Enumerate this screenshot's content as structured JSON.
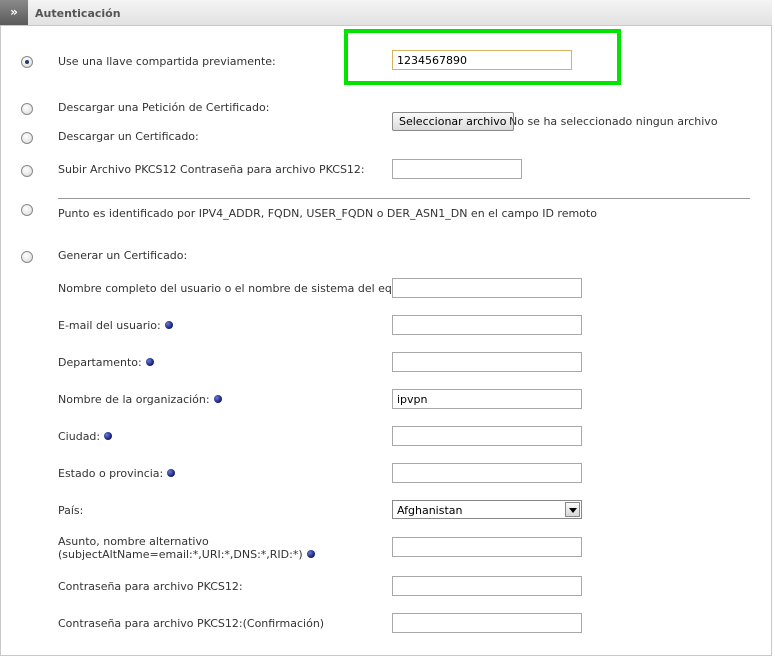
{
  "header": {
    "toggle_icon": "»",
    "title": "Autenticación"
  },
  "psk": {
    "label": "Use una llave compartida previamente:",
    "value": "1234567890",
    "selected": true
  },
  "download_request": {
    "label": "Descargar una Petición de Certificado:"
  },
  "download_cert": {
    "label": "Descargar un Certificado:"
  },
  "file_upload": {
    "button_label": "Seleccionar archivo",
    "status": "No se ha seleccionado ningun archivo"
  },
  "pkcs12_upload": {
    "label": "Subir Archivo PKCS12 Contraseña para archivo PKCS12:",
    "value": ""
  },
  "peer_id": {
    "label": "Punto es identificado por IPV4_ADDR, FQDN, USER_FQDN o DER_ASN1_DN en el campo ID remoto"
  },
  "generate": {
    "label": "Generar un Certificado:",
    "fields": [
      {
        "label": "Nombre completo del usuario o el nombre de sistema del equipo:",
        "value": "",
        "required": false
      },
      {
        "label": "E-mail del usuario:",
        "value": "",
        "required": true
      },
      {
        "label": "Departamento:",
        "value": "",
        "required": true
      },
      {
        "label": "Nombre de la organización:",
        "value": "ipvpn",
        "required": true
      },
      {
        "label": "Ciudad:",
        "value": "",
        "required": true
      },
      {
        "label": "Estado o provincia:",
        "value": "",
        "required": true
      }
    ],
    "country": {
      "label": "País:",
      "selected": "Afghanistan"
    },
    "altname": {
      "label_line1": "Asunto, nombre alternativo",
      "label_line2": "(subjectAltName=email:*,URI:*,DNS:*,RID:*)",
      "value": ""
    },
    "pkcs12_password": {
      "label": "Contraseña para archivo PKCS12:",
      "value": ""
    },
    "pkcs12_confirm": {
      "label": "Contraseña para archivo PKCS12:(Confirmación)",
      "value": ""
    }
  },
  "colors": {
    "highlight": "#00e400",
    "required_dot": "#10186a"
  }
}
